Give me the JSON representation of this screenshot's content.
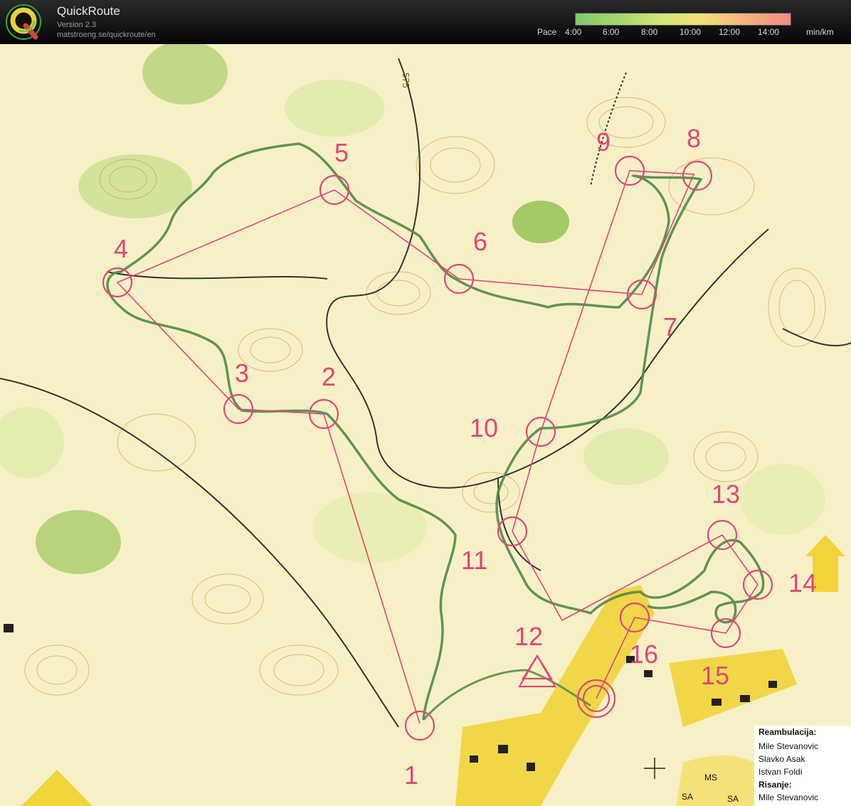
{
  "app": {
    "title": "QuickRoute",
    "version": "Version 2.3",
    "url": "matstroeng.se/quickroute/en",
    "logo_letter": "Q"
  },
  "pace_scale": {
    "label": "Pace",
    "ticks": [
      "4:00",
      "6:00",
      "8:00",
      "10:00",
      "12:00",
      "14:00"
    ],
    "unit": "min/km",
    "colors": [
      "#7fc96b",
      "#d8e57a",
      "#f2e27c",
      "#f08a88"
    ]
  },
  "map": {
    "course_color": "#e0457a",
    "route_color": "#4e8a46",
    "control_labels": [
      "1",
      "2",
      "3",
      "4",
      "5",
      "6",
      "7",
      "8",
      "9",
      "10",
      "11",
      "12",
      "13",
      "14",
      "15",
      "16"
    ],
    "number_575": "575",
    "symbols": [
      "MS",
      "SA",
      "SA"
    ]
  },
  "legend": {
    "heading_1": "Reambulacija:",
    "names_1": [
      "Mile Stevanovic",
      "Slavko Asak",
      "Istvan Foldi"
    ],
    "heading_2": "Risanje:",
    "names_2": [
      "Mile Stevanovic"
    ]
  }
}
